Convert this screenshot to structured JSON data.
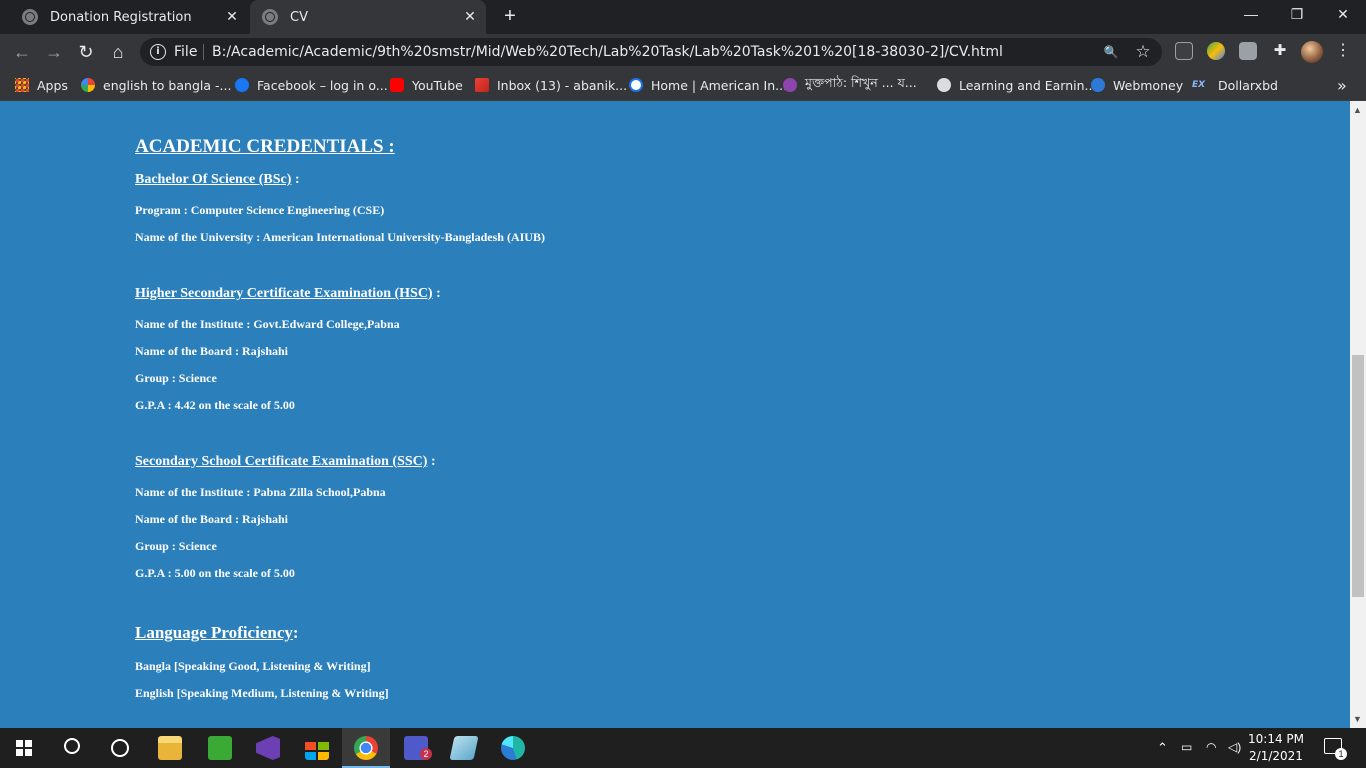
{
  "tabs": [
    {
      "title": "Donation Registration",
      "close": "✕"
    },
    {
      "title": "CV",
      "close": "✕"
    }
  ],
  "new_tab_glyph": "+",
  "window_controls": {
    "minimize": "—",
    "restore": "❐",
    "close": "✕"
  },
  "toolbar": {
    "back_glyph": "←",
    "forward_glyph": "→",
    "reload_glyph": "↻",
    "home_glyph": "⌂",
    "scheme": "File",
    "url": "B:/Academic/Academic/9th%20smstr/Mid/Web%20Tech/Lab%20Task/Lab%20Task%201%20[18-38030-2]/CV.html",
    "zoom_glyph": "🔍",
    "star_glyph": "☆",
    "menu_glyph": "⋮"
  },
  "bookmarks": [
    {
      "label": "Apps",
      "icon": "apps-grid-icon",
      "color": "#ea4335"
    },
    {
      "label": "english to bangla -...",
      "icon": "google-icon",
      "color": "#4285f4"
    },
    {
      "label": "Facebook – log in o...",
      "icon": "facebook-icon",
      "color": "#1877f2"
    },
    {
      "label": "YouTube",
      "icon": "youtube-icon",
      "color": "#ff0000"
    },
    {
      "label": "Inbox (13) - abanik...",
      "icon": "gmail-icon",
      "color": "#ea4335"
    },
    {
      "label": "Home | American In...",
      "icon": "aiub-icon",
      "color": "#1a73e8"
    },
    {
      "label": "মুক্তপাঠ: শিখুন ... য...",
      "icon": "muktopaath-icon",
      "color": "#8e44ad"
    },
    {
      "label": "Learning and Earnin...",
      "icon": "globe-icon",
      "color": "#dadce0"
    },
    {
      "label": "Webmoney",
      "icon": "webmoney-icon",
      "color": "#2d7ad6"
    },
    {
      "label": "Dollarxbd",
      "icon": "ex-icon",
      "color": "#1a73e8"
    }
  ],
  "bookmarks_more": "»",
  "cv": {
    "academic_heading": "ACADEMIC CREDENTIALS",
    "heading_suffix": " :",
    "bsc": {
      "title": "Bachelor Of Science (BSc)",
      "program": "Program : Computer Science Engineering (CSE)",
      "university": "Name of the University : American International University-Bangladesh (AIUB)"
    },
    "hsc": {
      "title": "Higher Secondary Certificate Examination (HSC)",
      "institute": "Name of the Institute : Govt.Edward College,Pabna",
      "board": "Name of the Board : Rajshahi",
      "group": "Group : Science",
      "gpa": "G.P.A : 4.42 on the scale of 5.00"
    },
    "ssc": {
      "title": "Secondary School Certificate Examination (SSC)",
      "institute": "Name of the Institute : Pabna Zilla School,Pabna",
      "board": "Name of the Board : Rajshahi",
      "group": "Group : Science",
      "gpa": "G.P.A : 5.00 on the scale of 5.00"
    },
    "language_heading": "Language Proficiency",
    "languages": [
      "Bangla [Speaking Good, Listening & Writing]",
      "English [Speaking Medium, Listening & Writing]"
    ]
  },
  "taskbar": {
    "clock_time": "10:14 PM",
    "clock_date": "2/1/2021",
    "teams_badge": "2",
    "notification_badge": "1"
  },
  "colors": {
    "page_background": "#2b7fba",
    "tabstrip": "#202124",
    "toolbar": "#35363a",
    "taskbar": "#1f1f1f"
  }
}
